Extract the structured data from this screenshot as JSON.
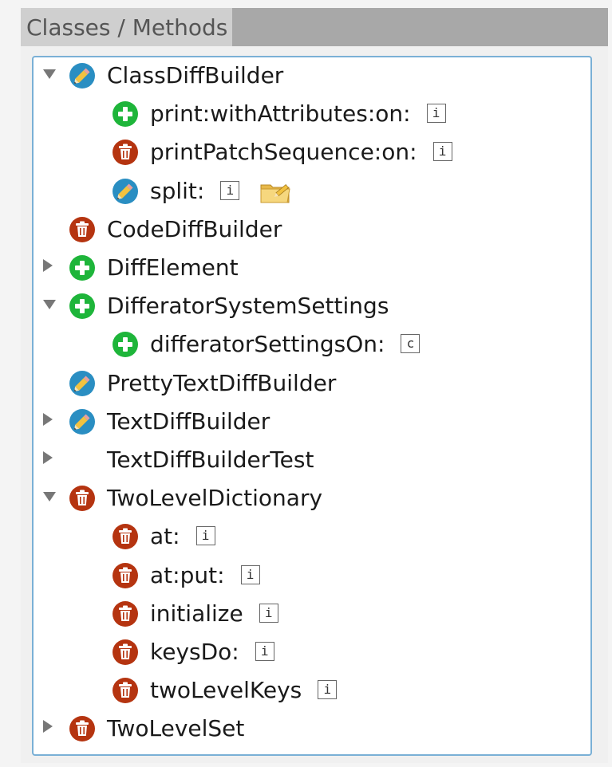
{
  "panel": {
    "title": "Classes / Methods"
  },
  "tree": {
    "rows": [
      {
        "label": "ClassDiffBuilder",
        "icon": "pencil-modified",
        "toggle": "expanded",
        "level": 0
      },
      {
        "label": "print:withAttributes:on:",
        "icon": "plus-added",
        "badge": "i",
        "level": 1
      },
      {
        "label": "printPatchSequence:on:",
        "icon": "trash-removed",
        "badge": "i",
        "level": 1
      },
      {
        "label": "split:",
        "icon": "pencil-modified",
        "badge": "i",
        "extra": "folder-edit-icon",
        "level": 1
      },
      {
        "label": "CodeDiffBuilder",
        "icon": "trash-removed",
        "level": 0
      },
      {
        "label": "DiffElement",
        "icon": "plus-added",
        "toggle": "collapsed",
        "level": 0
      },
      {
        "label": "DifferatorSystemSettings",
        "icon": "plus-added",
        "toggle": "expanded",
        "level": 0
      },
      {
        "label": "differatorSettingsOn:",
        "icon": "plus-added",
        "badge": "c",
        "level": 1
      },
      {
        "label": "PrettyTextDiffBuilder",
        "icon": "pencil-modified",
        "level": 0
      },
      {
        "label": "TextDiffBuilder",
        "icon": "pencil-modified",
        "toggle": "collapsed",
        "level": 0
      },
      {
        "label": "TextDiffBuilderTest",
        "toggle": "collapsed",
        "level": 0
      },
      {
        "label": "TwoLevelDictionary",
        "icon": "trash-removed",
        "toggle": "expanded",
        "level": 0
      },
      {
        "label": "at:",
        "icon": "trash-removed",
        "badge": "i",
        "level": 1
      },
      {
        "label": "at:put:",
        "icon": "trash-removed",
        "badge": "i",
        "level": 1
      },
      {
        "label": "initialize",
        "icon": "trash-removed",
        "badge": "i",
        "level": 1
      },
      {
        "label": "keysDo:",
        "icon": "trash-removed",
        "badge": "i",
        "level": 1
      },
      {
        "label": "twoLevelKeys",
        "icon": "trash-removed",
        "badge": "i",
        "level": 1
      },
      {
        "label": "TwoLevelSet",
        "icon": "trash-removed",
        "toggle": "collapsed",
        "level": 0
      }
    ]
  },
  "colors": {
    "added": "#1eb53a",
    "removed": "#b53410",
    "modified": "#2a8ec2",
    "selection_border": "#7ab0d6"
  }
}
